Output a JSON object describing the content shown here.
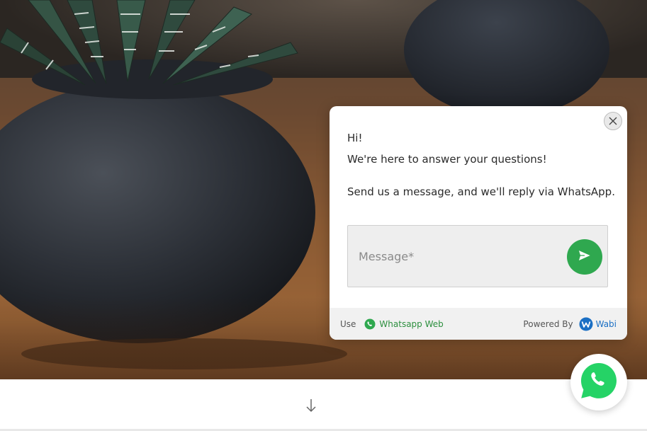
{
  "chat": {
    "greeting": "Hi!",
    "intro": "We're here to answer your questions!",
    "description": "Send us a message, and we'll reply via WhatsApp.",
    "message_placeholder": "Message*",
    "footer": {
      "use_label": "Use",
      "whatsapp_web_label": "Whatsapp Web",
      "powered_by_label": "Powered By",
      "brand_label": "Wabi"
    }
  },
  "icons": {
    "close": "close-icon",
    "send": "send-icon",
    "whatsapp": "whatsapp-icon",
    "wabi_logo": "wabi-logo-icon",
    "scroll_down": "arrow-down-icon"
  },
  "colors": {
    "whatsapp_green": "#2fa84f",
    "whatsapp_float_green": "#25d366",
    "wabi_blue": "#1a6fc4"
  }
}
